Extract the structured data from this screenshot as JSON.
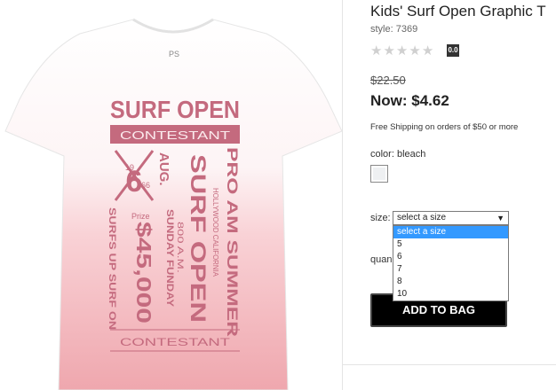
{
  "product": {
    "title": "Kids' Surf Open Graphic T",
    "style": "style: 7369",
    "rating_value": "0.0",
    "old_price": "$22.50",
    "now_price": "Now: $4.62",
    "shipping": "Free Shipping on orders of $50 or more"
  },
  "image": {
    "alt": "Kids' Surf Open Graphic T shirt in bleach",
    "label": "PS",
    "graphic": {
      "headline": "SURF OPEN",
      "banner": "CONTESTANT",
      "vertical_1": "SURF OPEN",
      "vertical_2": "PRO AM SUMMER",
      "vertical_3": "HOLLYWOOD CALIFORNIA",
      "aug": "AUG.",
      "day": "6",
      "year_1": "19",
      "year_2": "66",
      "prize": "Prize",
      "amount": "$45,000",
      "sunday": "SUNDAY FUNDAY",
      "time": "800 A.M.",
      "surfs": "SURFS UP SURF ON",
      "footer": "CONTESTANT"
    }
  },
  "color": {
    "label": "color: bleach",
    "swatch_color": "#eef0f2"
  },
  "size": {
    "label": "size:",
    "selected": "select a size",
    "arrow_icon": "triangle-down",
    "options": [
      "select a size",
      "5",
      "6",
      "7",
      "8",
      "10"
    ]
  },
  "quantity": {
    "label": "quan"
  },
  "add_to_bag": "ADD TO BAG",
  "colors": {
    "print": "#c46a7e",
    "dip_dye": "#f0aab0",
    "select_highlight": "#3399ff"
  }
}
